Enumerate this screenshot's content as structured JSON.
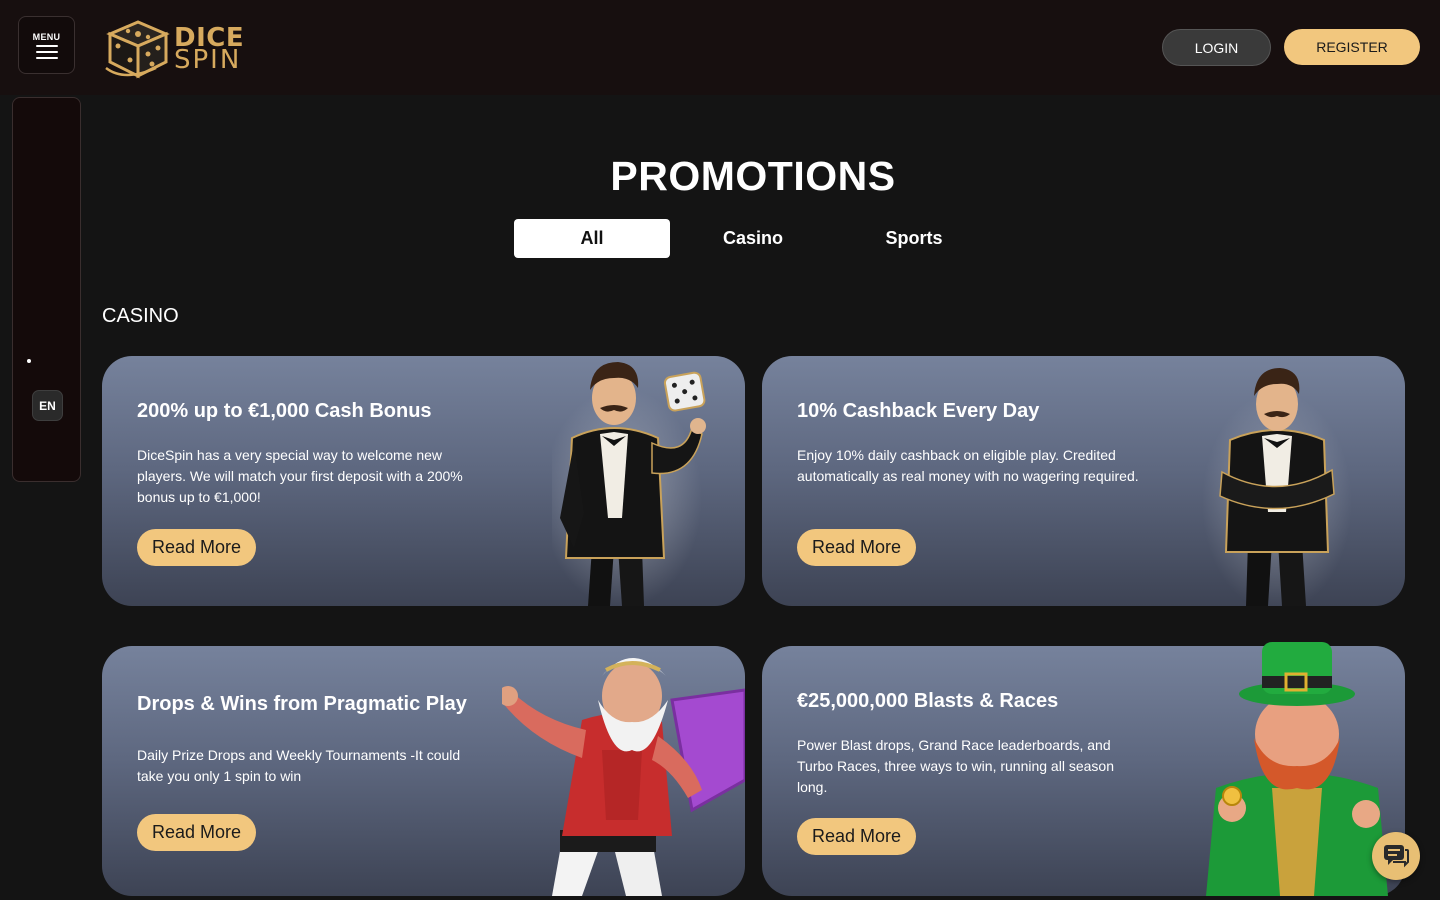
{
  "header": {
    "menu_label": "MENU",
    "logo_line1": "DICE",
    "logo_line2": "SPIN",
    "login_label": "LOGIN",
    "register_label": "REGISTER"
  },
  "sidebar": {
    "language": "EN"
  },
  "main": {
    "title": "PROMOTIONS",
    "tabs": [
      {
        "label": "All",
        "active": true
      },
      {
        "label": "Casino",
        "active": false
      },
      {
        "label": "Sports",
        "active": false
      }
    ],
    "section_label": "CASINO",
    "cards": [
      {
        "title": "200% up to €1,000 Cash Bonus",
        "description": "DiceSpin has a very special way to welcome new players. We will match your first deposit with a 200% bonus up to €1,000!",
        "button": "Read More"
      },
      {
        "title": "10% Cashback Every Day",
        "description": "Enjoy 10% daily cashback on eligible play. Credited automatically as real money with no wagering required.",
        "button": "Read More"
      },
      {
        "title": "Drops & Wins from Pragmatic Play",
        "description": "Daily Prize Drops and Weekly Tournaments -It could take you only 1 spin to win",
        "button": "Read More"
      },
      {
        "title": "€25,000,000 Blasts & Races",
        "description": "Power Blast drops, Grand Race leaderboards, and Turbo Races, three ways to win, running all season long.",
        "button": "Read More"
      }
    ]
  },
  "colors": {
    "accent_gold": "#f2c77e",
    "header_bg": "#170f0f",
    "page_bg": "#141414"
  }
}
